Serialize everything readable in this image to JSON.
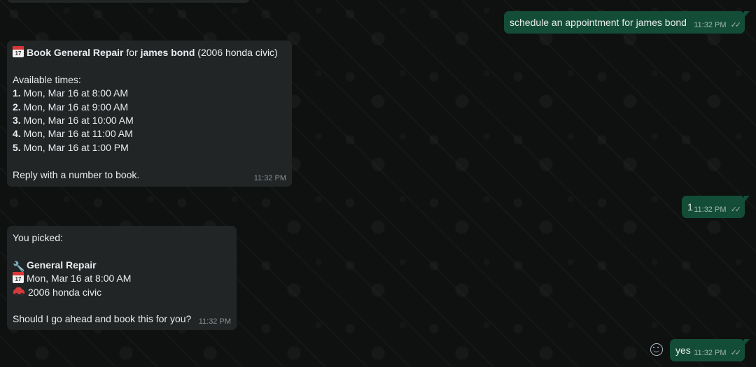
{
  "messages": {
    "m1": {
      "text": "schedule an appointment for james bond",
      "time": "11:32 PM"
    },
    "m2": {
      "title_bold": "Book General Repair",
      "title_mid": " for ",
      "title_name": "james bond",
      "title_tail": " (2006 honda civic)",
      "available": "Available times:",
      "options": [
        {
          "num": "1.",
          "text": " Mon, Mar 16 at 8:00 AM"
        },
        {
          "num": "2.",
          "text": " Mon, Mar 16 at 9:00 AM"
        },
        {
          "num": "3.",
          "text": " Mon, Mar 16 at 10:00 AM"
        },
        {
          "num": "4.",
          "text": " Mon, Mar 16 at 11:00 AM"
        },
        {
          "num": "5.",
          "text": " Mon, Mar 16 at 1:00 PM"
        }
      ],
      "footer": "Reply with a number to book.",
      "time": "11:32 PM"
    },
    "m3": {
      "text": "1",
      "time": "11:32 PM"
    },
    "m4": {
      "intro": "You picked:",
      "service": "General Repair",
      "datetime": "Mon, Mar 16 at 8:00 AM",
      "vehicle": "2006 honda civic",
      "question": "Should I go ahead and book this for you?",
      "time": "11:32 PM"
    },
    "m5": {
      "text": "yes",
      "time": "11:32 PM"
    }
  },
  "icons": {
    "read_receipt": "double-check-icon",
    "calendar": "calendar-icon",
    "wrench": "wrench-icon",
    "car": "car-icon",
    "emoji": "emoji-icon"
  },
  "colors": {
    "outgoing_bubble": "#144d37",
    "incoming_bubble": "#222526",
    "background": "#0f1111"
  }
}
